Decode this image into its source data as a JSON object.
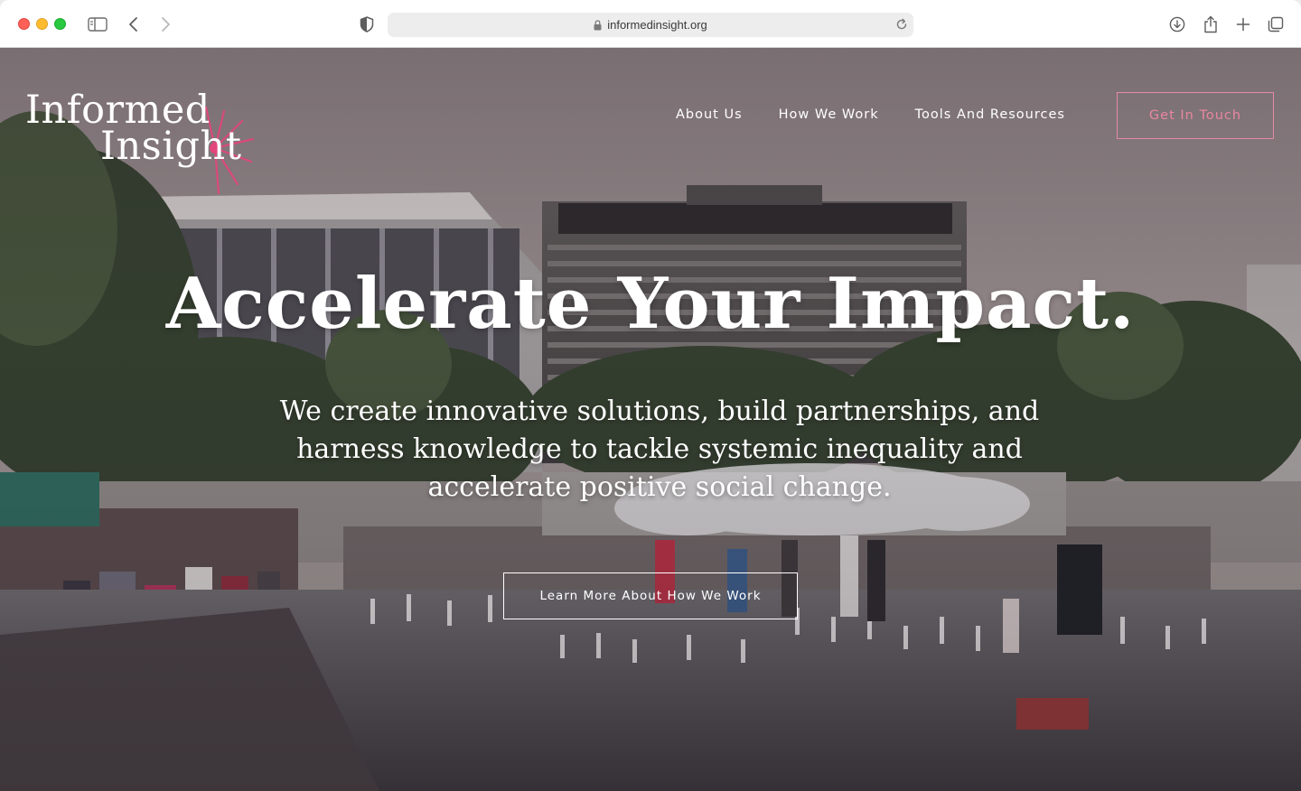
{
  "browser": {
    "url": "informedinsight.org",
    "icons": {
      "sidebar": "sidebar-icon",
      "back": "chevron-left-icon",
      "forward": "chevron-right-icon",
      "privacy": "shield-icon",
      "lock": "lock-icon",
      "reload": "reload-icon",
      "download": "download-icon",
      "share": "share-icon",
      "new_tab": "plus-icon",
      "tabs": "tabs-overview-icon"
    }
  },
  "site": {
    "logo": {
      "line1": "Informed",
      "line2": "Insight",
      "accent_color": "#e3467a"
    },
    "nav": {
      "items": [
        {
          "label": "About Us"
        },
        {
          "label": "How We Work"
        },
        {
          "label": "Tools And Resources"
        }
      ],
      "cta_label": "Get In Touch",
      "cta_color": "#e9879f"
    },
    "hero": {
      "headline": "Accelerate Your Impact.",
      "subheadline": "We create innovative solutions, build partnerships, and harness knowledge to tackle systemic inequality and accelerate positive social change.",
      "button_label": "Learn More About How We Work"
    }
  }
}
